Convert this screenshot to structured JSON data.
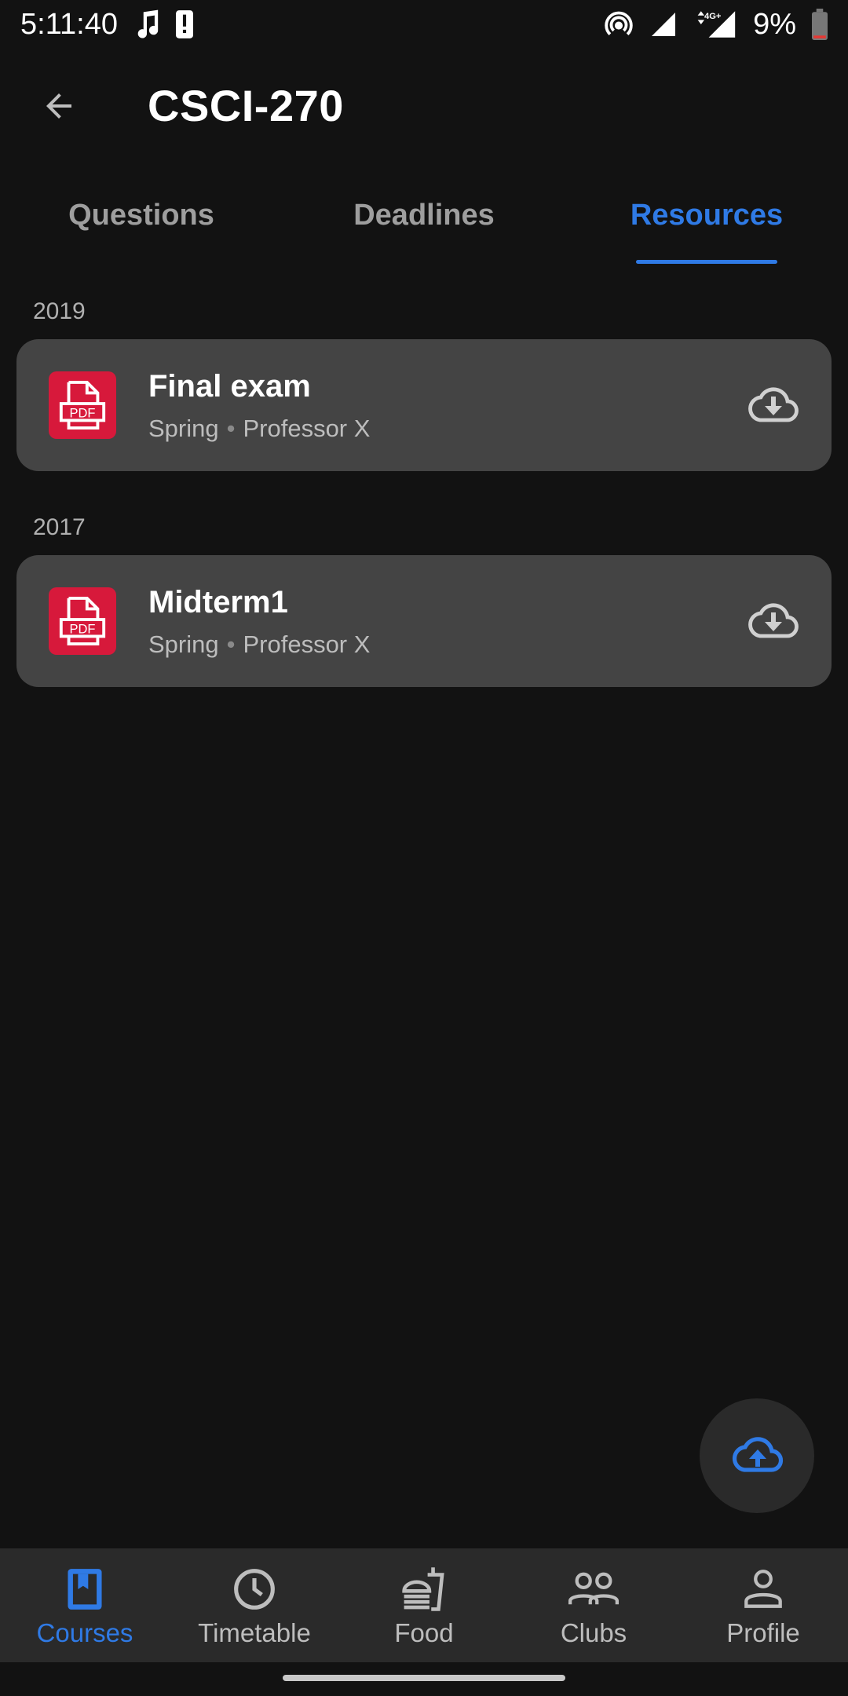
{
  "status_bar": {
    "time": "5:11:40",
    "battery": "9%",
    "network": "4G+"
  },
  "header": {
    "title": "CSCI-270"
  },
  "tabs": [
    {
      "label": "Questions",
      "active": false
    },
    {
      "label": "Deadlines",
      "active": false
    },
    {
      "label": "Resources",
      "active": true
    }
  ],
  "sections": [
    {
      "year": "2019",
      "items": [
        {
          "title": "Final exam",
          "term": "Spring",
          "professor": "Professor X",
          "file_type": "PDF"
        }
      ]
    },
    {
      "year": "2017",
      "items": [
        {
          "title": "Midterm1",
          "term": "Spring",
          "professor": "Professor X",
          "file_type": "PDF"
        }
      ]
    }
  ],
  "bottom_nav": [
    {
      "label": "Courses",
      "icon": "book-icon",
      "active": true
    },
    {
      "label": "Timetable",
      "icon": "clock-icon",
      "active": false
    },
    {
      "label": "Food",
      "icon": "fastfood-icon",
      "active": false
    },
    {
      "label": "Clubs",
      "icon": "group-icon",
      "active": false
    },
    {
      "label": "Profile",
      "icon": "person-icon",
      "active": false
    }
  ],
  "colors": {
    "background": "#121212",
    "card": "#444444",
    "accent": "#2f7ae5",
    "pdf": "#d7193b",
    "nav_background": "#2a2a2a"
  }
}
